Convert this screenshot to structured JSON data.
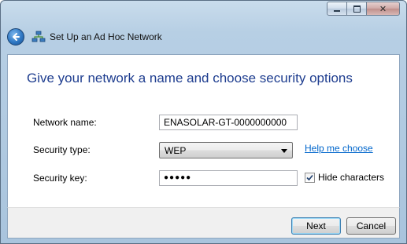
{
  "window": {
    "title": "Set Up an Ad Hoc Network",
    "controls": [
      "minimize-icon",
      "maximize-icon",
      "close-icon"
    ]
  },
  "page": {
    "heading": "Give your network a name and choose security options"
  },
  "form": {
    "network_name": {
      "label": "Network name:",
      "value": "ENASOLAR-GT-0000000000"
    },
    "security_type": {
      "label": "Security type:",
      "selected": "WEP"
    },
    "security_key": {
      "label": "Security key:",
      "value": "●●●●●"
    },
    "help_link": "Help me choose",
    "hide_characters": {
      "label": "Hide characters",
      "checked": true
    }
  },
  "buttons": {
    "next": "Next",
    "cancel": "Cancel"
  },
  "colors": {
    "heading": "#1e3d8f",
    "link": "#0066cc",
    "frame": "#b7cfe4"
  }
}
